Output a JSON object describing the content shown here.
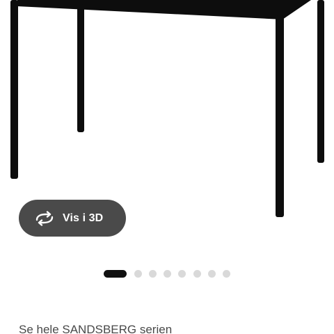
{
  "view_3d": {
    "label": "Vis i 3D",
    "icon": "rotate-3d-icon"
  },
  "carousel": {
    "total": 8,
    "active_index": 1
  },
  "series_link": {
    "text": "Se hele SANDSBERG serien"
  },
  "colors": {
    "button_bg": "#4a4a4a",
    "dot_active": "#111111",
    "dot_inactive": "#d9d9d9",
    "table": "#0d0d0d"
  }
}
